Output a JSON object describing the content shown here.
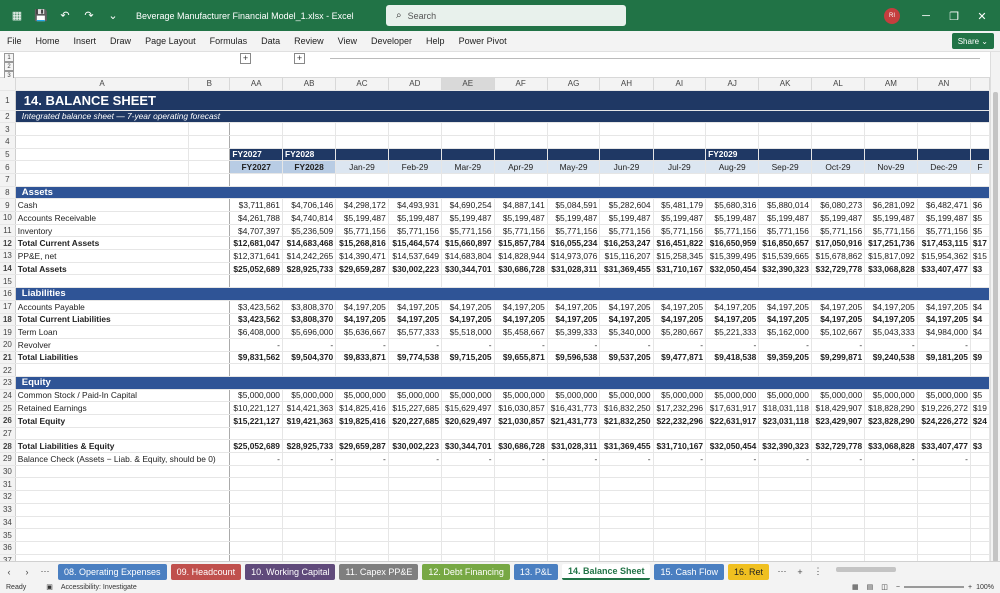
{
  "window": {
    "title": "Beverage Manufacturer Financial Model_1.xlsx  -  Excel",
    "search_placeholder": "Search",
    "avatar_initials": "RI"
  },
  "menu": [
    "File",
    "Home",
    "Insert",
    "Draw",
    "Page Layout",
    "Formulas",
    "Data",
    "Review",
    "View",
    "Developer",
    "Help",
    "Power Pivot"
  ],
  "share_label": "Share",
  "outline_levels": [
    "1",
    "2",
    "3"
  ],
  "columns": [
    {
      "letter": "A",
      "w": 178
    },
    {
      "letter": "B",
      "w": 42
    },
    {
      "letter": "AA",
      "w": 53
    },
    {
      "letter": "AB",
      "w": 54
    },
    {
      "letter": "AC",
      "w": 53
    },
    {
      "letter": "AD",
      "w": 54
    },
    {
      "letter": "AE",
      "w": 53
    },
    {
      "letter": "AF",
      "w": 54
    },
    {
      "letter": "AG",
      "w": 53
    },
    {
      "letter": "AH",
      "w": 54
    },
    {
      "letter": "AI",
      "w": 53
    },
    {
      "letter": "AJ",
      "w": 54
    },
    {
      "letter": "AK",
      "w": 53
    },
    {
      "letter": "AL",
      "w": 54
    },
    {
      "letter": "AM",
      "w": 53
    },
    {
      "letter": "AN",
      "w": 54
    },
    {
      "letter": "",
      "w": 17
    }
  ],
  "sheet_title": "14.  BALANCE SHEET",
  "sheet_subtitle": "Integrated balance sheet — 7-year operating forecast",
  "fy_row": [
    "FY2027",
    "FY2028",
    "",
    "",
    "",
    "",
    "",
    "",
    "",
    "FY2029",
    "",
    "",
    "",
    "",
    "",
    ""
  ],
  "month_row": [
    "FY2027",
    "FY2028",
    "Jan-29",
    "Feb-29",
    "Mar-29",
    "Apr-29",
    "May-29",
    "Jun-29",
    "Jul-29",
    "Aug-29",
    "Sep-29",
    "Oct-29",
    "Nov-29",
    "Dec-29",
    "F"
  ],
  "rows": [
    {
      "n": "8",
      "label": "Assets",
      "type": "section"
    },
    {
      "n": "9",
      "label": "Cash",
      "vals": [
        "$3,711,861",
        "$4,706,146",
        "$4,298,172",
        "$4,493,931",
        "$4,690,254",
        "$4,887,141",
        "$5,084,591",
        "$5,282,604",
        "$5,481,179",
        "$5,680,316",
        "$5,880,014",
        "$6,080,273",
        "$6,281,092",
        "$6,482,471",
        "$6"
      ]
    },
    {
      "n": "10",
      "label": "Accounts Receivable",
      "vals": [
        "$4,261,788",
        "$4,740,814",
        "$5,199,487",
        "$5,199,487",
        "$5,199,487",
        "$5,199,487",
        "$5,199,487",
        "$5,199,487",
        "$5,199,487",
        "$5,199,487",
        "$5,199,487",
        "$5,199,487",
        "$5,199,487",
        "$5,199,487",
        "$5"
      ]
    },
    {
      "n": "11",
      "label": "Inventory",
      "vals": [
        "$4,707,397",
        "$5,236,509",
        "$5,771,156",
        "$5,771,156",
        "$5,771,156",
        "$5,771,156",
        "$5,771,156",
        "$5,771,156",
        "$5,771,156",
        "$5,771,156",
        "$5,771,156",
        "$5,771,156",
        "$5,771,156",
        "$5,771,156",
        "$5"
      ]
    },
    {
      "n": "12",
      "label": "Total Current Assets",
      "bold": true,
      "vals": [
        "$12,681,047",
        "$14,683,468",
        "$15,268,816",
        "$15,464,574",
        "$15,660,897",
        "$15,857,784",
        "$16,055,234",
        "$16,253,247",
        "$16,451,822",
        "$16,650,959",
        "$16,850,657",
        "$17,050,916",
        "$17,251,736",
        "$17,453,115",
        "$17"
      ]
    },
    {
      "n": "13",
      "label": "PP&E, net",
      "vals": [
        "$12,371,641",
        "$14,242,265",
        "$14,390,471",
        "$14,537,649",
        "$14,683,804",
        "$14,828,944",
        "$14,973,076",
        "$15,116,207",
        "$15,258,345",
        "$15,399,495",
        "$15,539,665",
        "$15,678,862",
        "$15,817,092",
        "$15,954,362",
        "$15"
      ]
    },
    {
      "n": "14",
      "label": "Total Assets",
      "bold": true,
      "vals": [
        "$25,052,689",
        "$28,925,733",
        "$29,659,287",
        "$30,002,223",
        "$30,344,701",
        "$30,686,728",
        "$31,028,311",
        "$31,369,455",
        "$31,710,167",
        "$32,050,454",
        "$32,390,323",
        "$32,729,778",
        "$33,068,828",
        "$33,407,477",
        "$3"
      ]
    },
    {
      "n": "15",
      "label": "",
      "vals": []
    },
    {
      "n": "16",
      "label": "Liabilities",
      "type": "section"
    },
    {
      "n": "17",
      "label": "Accounts Payable",
      "vals": [
        "$3,423,562",
        "$3,808,370",
        "$4,197,205",
        "$4,197,205",
        "$4,197,205",
        "$4,197,205",
        "$4,197,205",
        "$4,197,205",
        "$4,197,205",
        "$4,197,205",
        "$4,197,205",
        "$4,197,205",
        "$4,197,205",
        "$4,197,205",
        "$4"
      ]
    },
    {
      "n": "18",
      "label": "Total Current Liabilities",
      "bold": true,
      "vals": [
        "$3,423,562",
        "$3,808,370",
        "$4,197,205",
        "$4,197,205",
        "$4,197,205",
        "$4,197,205",
        "$4,197,205",
        "$4,197,205",
        "$4,197,205",
        "$4,197,205",
        "$4,197,205",
        "$4,197,205",
        "$4,197,205",
        "$4,197,205",
        "$4"
      ]
    },
    {
      "n": "19",
      "label": "Term Loan",
      "vals": [
        "$6,408,000",
        "$5,696,000",
        "$5,636,667",
        "$5,577,333",
        "$5,518,000",
        "$5,458,667",
        "$5,399,333",
        "$5,340,000",
        "$5,280,667",
        "$5,221,333",
        "$5,162,000",
        "$5,102,667",
        "$5,043,333",
        "$4,984,000",
        "$4"
      ]
    },
    {
      "n": "20",
      "label": "Revolver",
      "vals": [
        "-",
        "-",
        "-",
        "-",
        "-",
        "-",
        "-",
        "-",
        "-",
        "-",
        "-",
        "-",
        "-",
        "-",
        ""
      ]
    },
    {
      "n": "21",
      "label": "Total Liabilities",
      "bold": true,
      "vals": [
        "$9,831,562",
        "$9,504,370",
        "$9,833,871",
        "$9,774,538",
        "$9,715,205",
        "$9,655,871",
        "$9,596,538",
        "$9,537,205",
        "$9,477,871",
        "$9,418,538",
        "$9,359,205",
        "$9,299,871",
        "$9,240,538",
        "$9,181,205",
        "$9"
      ]
    },
    {
      "n": "22",
      "label": "",
      "vals": []
    },
    {
      "n": "23",
      "label": "Equity",
      "type": "section"
    },
    {
      "n": "24",
      "label": "Common Stock / Paid-In Capital",
      "vals": [
        "$5,000,000",
        "$5,000,000",
        "$5,000,000",
        "$5,000,000",
        "$5,000,000",
        "$5,000,000",
        "$5,000,000",
        "$5,000,000",
        "$5,000,000",
        "$5,000,000",
        "$5,000,000",
        "$5,000,000",
        "$5,000,000",
        "$5,000,000",
        "$5"
      ]
    },
    {
      "n": "25",
      "label": "Retained Earnings",
      "vals": [
        "$10,221,127",
        "$14,421,363",
        "$14,825,416",
        "$15,227,685",
        "$15,629,497",
        "$16,030,857",
        "$16,431,773",
        "$16,832,250",
        "$17,232,296",
        "$17,631,917",
        "$18,031,118",
        "$18,429,907",
        "$18,828,290",
        "$19,226,272",
        "$19"
      ]
    },
    {
      "n": "26",
      "label": "Total Equity",
      "bold": true,
      "vals": [
        "$15,221,127",
        "$19,421,363",
        "$19,825,416",
        "$20,227,685",
        "$20,629,497",
        "$21,030,857",
        "$21,431,773",
        "$21,832,250",
        "$22,232,296",
        "$22,631,917",
        "$23,031,118",
        "$23,429,907",
        "$23,828,290",
        "$24,226,272",
        "$24"
      ]
    },
    {
      "n": "27",
      "label": "",
      "vals": []
    },
    {
      "n": "28",
      "label": "Total Liabilities & Equity",
      "bold": true,
      "vals": [
        "$25,052,689",
        "$28,925,733",
        "$29,659,287",
        "$30,002,223",
        "$30,344,701",
        "$30,686,728",
        "$31,028,311",
        "$31,369,455",
        "$31,710,167",
        "$32,050,454",
        "$32,390,323",
        "$32,729,778",
        "$33,068,828",
        "$33,407,477",
        "$3"
      ]
    },
    {
      "n": "29",
      "label": "Balance Check (Assets − Liab. & Equity, should be 0)",
      "vals": [
        "-",
        "-",
        "-",
        "-",
        "-",
        "-",
        "-",
        "-",
        "-",
        "-",
        "-",
        "-",
        "-",
        "-",
        ""
      ]
    },
    {
      "n": "30",
      "label": "",
      "vals": []
    },
    {
      "n": "31",
      "label": "",
      "vals": []
    },
    {
      "n": "32",
      "label": "",
      "vals": []
    },
    {
      "n": "33",
      "label": "",
      "vals": []
    },
    {
      "n": "34",
      "label": "",
      "vals": []
    },
    {
      "n": "35",
      "label": "",
      "vals": []
    },
    {
      "n": "36",
      "label": "",
      "vals": []
    },
    {
      "n": "37",
      "label": "",
      "vals": []
    }
  ],
  "sheet_tabs": [
    {
      "label": "08. Operating Expenses",
      "color": "#4a7fc1"
    },
    {
      "label": "09. Headcount",
      "color": "#c0504d"
    },
    {
      "label": "10. Working Capital",
      "color": "#604a7b"
    },
    {
      "label": "11. Capex PP&E",
      "color": "#7f7f7f"
    },
    {
      "label": "12. Debt Financing",
      "color": "#77a844"
    },
    {
      "label": "13. P&L",
      "color": "#4a7fc1"
    },
    {
      "label": "14. Balance Sheet",
      "color": "#ffffff",
      "active": true
    },
    {
      "label": "15. Cash Flow",
      "color": "#4a7fc1"
    },
    {
      "label": "16. Ret",
      "color": "#f0c020"
    }
  ],
  "status": {
    "ready": "Ready",
    "accessibility": "Accessibility: Investigate",
    "zoom": "100%"
  }
}
